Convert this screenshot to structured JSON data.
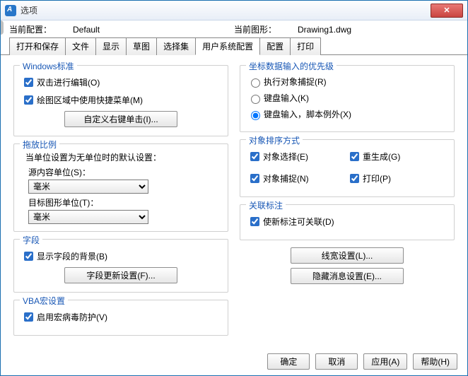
{
  "window": {
    "title": "选项"
  },
  "header": {
    "current_profile_label": "当前配置：",
    "current_profile_value": "Default",
    "current_drawing_label": "当前图形：",
    "current_drawing_value": "Drawing1.dwg"
  },
  "tabs": [
    "打开和保存",
    "文件",
    "显示",
    "草图",
    "选择集",
    "用户系统配置",
    "配置",
    "打印"
  ],
  "active_tab_index": 5,
  "left": {
    "group_windows": {
      "title": "Windows标准",
      "chk_dblclick": "双击进行编辑(O)",
      "chk_shortcut_menu": "绘图区域中使用快捷菜单(M)",
      "btn_rightclick": "自定义右键单击(I)..."
    },
    "group_scale": {
      "title": "拖放比例",
      "note": "当单位设置为无单位时的默认设置：",
      "src_label": "源内容单位(S)：",
      "src_value": "毫米",
      "tgt_label": "目标图形单位(T)：",
      "tgt_value": "毫米"
    },
    "group_field": {
      "title": "字段",
      "chk_bg": "显示字段的背景(B)",
      "btn_update": "字段更新设置(F)..."
    },
    "group_vba": {
      "title": "VBA宏设置",
      "chk_virus": "启用宏病毒防护(V)"
    }
  },
  "right": {
    "group_priority": {
      "title": "坐标数据输入的优先级",
      "opt_osnap": "执行对象捕捉(R)",
      "opt_key": "键盘输入(K)",
      "opt_key_except": "键盘输入，脚本例外(X)",
      "selected": 2
    },
    "group_sort": {
      "title": "对象排序方式",
      "chk_sel": "对象选择(E)",
      "chk_regen": "重生成(G)",
      "chk_snap": "对象捕捉(N)",
      "chk_plot": "打印(P)"
    },
    "group_assoc": {
      "title": "关联标注",
      "chk_assoc": "使新标注可关联(D)"
    },
    "btn_lineweight": "线宽设置(L)...",
    "btn_hidemsg": "隐藏消息设置(E)..."
  },
  "footer": {
    "ok": "确定",
    "cancel": "取消",
    "apply": "应用(A)",
    "help": "帮助(H)"
  }
}
